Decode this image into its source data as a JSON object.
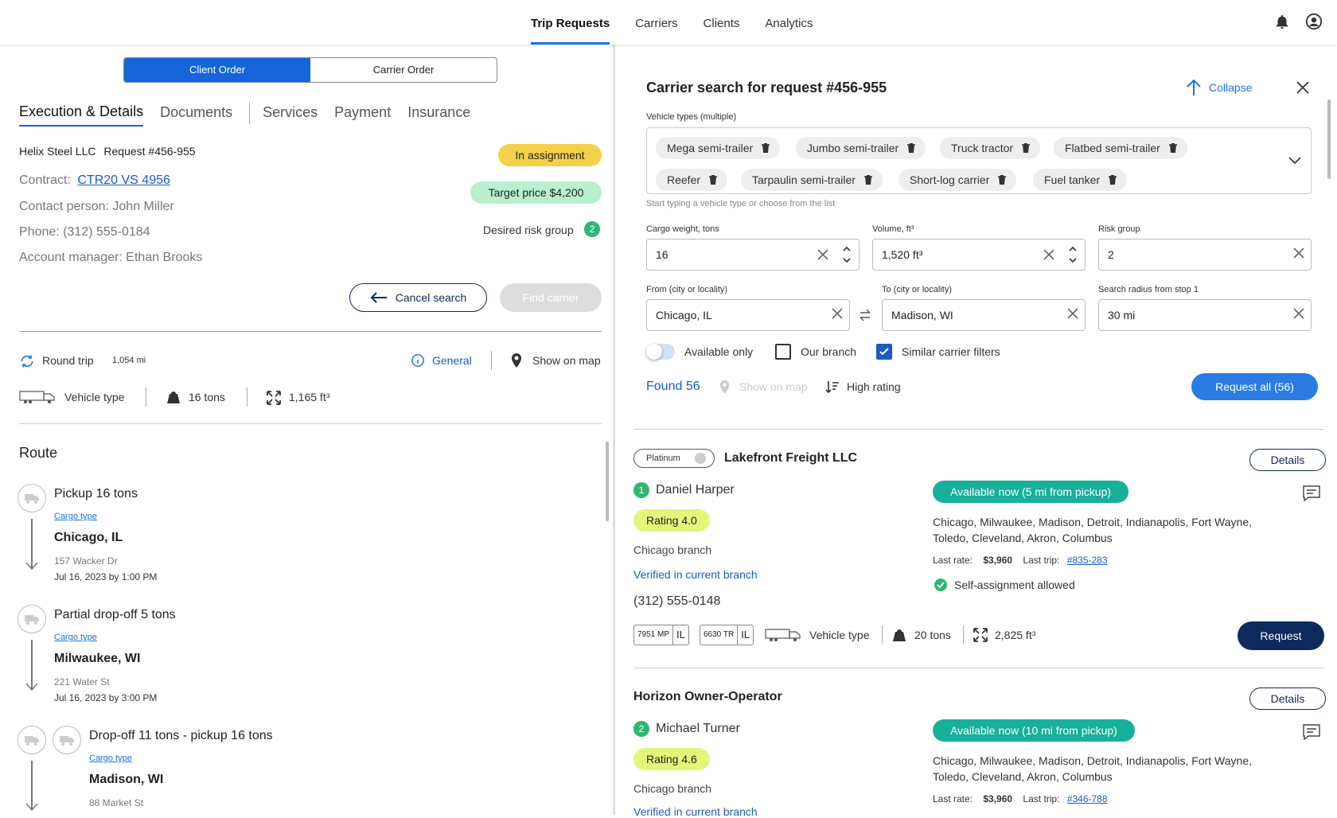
{
  "nav": {
    "items": [
      "Trip Requests",
      "Carriers",
      "Clients",
      "Analytics"
    ]
  },
  "left": {
    "toggle": {
      "client": "Client Order",
      "carrier": "Carrier Order"
    },
    "tabs": [
      "Execution & Details",
      "Documents",
      "Services",
      "Payment",
      "Insurance"
    ],
    "client_name": "Helix Steel LLC",
    "request_label": "Request #456-955",
    "status": "In assignment",
    "contract_label": "Contract:",
    "contract_link": "CTR20 VS 4956",
    "target_price": "Target price $4,200",
    "contact": "Contact person: John Miller",
    "phone": "Phone: (312) 555-0184",
    "desired_risk": "Desired risk group",
    "desired_risk_value": "2",
    "account_manager": "Account manager: Ethan Brooks",
    "cancel": "Cancel search",
    "find": "Find carrier",
    "trip_type": "Round trip",
    "distance": "1,054 mi",
    "general": "General",
    "show_map": "Show on map",
    "vehicle_type": "Vehicle type",
    "tons": "16 tons",
    "volume": "1,165 ft³",
    "route_title": "Route",
    "stops": [
      {
        "title": "Pickup 16 tons",
        "cargo": "Cargo type",
        "city": "Chicago, IL",
        "address": "157 Wacker Dr",
        "time": "Jul 16, 2023 by 1:00 PM"
      },
      {
        "title": "Partial drop-off 5 tons",
        "cargo": "Cargo type",
        "city": "Milwaukee, WI",
        "address": "221 Water St",
        "time": "Jul 16, 2023 by 3:00 PM"
      },
      {
        "title": "Drop-off 11 tons - pickup 16 tons",
        "cargo": "Cargo type",
        "city": "Madison, WI",
        "address": "88 Market St"
      }
    ]
  },
  "right": {
    "title": "Carrier search for request #456-955",
    "collapse": "Collapse",
    "vehicle_types_label": "Vehicle types (multiple)",
    "chips": [
      "Mega semi-trailer",
      "Jumbo semi-trailer",
      "Truck tractor",
      "Flatbed semi-trailer",
      "Reefer",
      "Tarpaulin semi-trailer",
      "Short-log carrier",
      "Fuel tanker"
    ],
    "chip_hint": "Start typing a vehicle type or choose from the list",
    "cargo_weight_label": "Cargo weight, tons",
    "cargo_weight": "16",
    "volume_label": "Volume, ft³",
    "volume": "1,520 ft³",
    "risk_label": "Risk group",
    "risk": "2",
    "from_label": "From (city or locality)",
    "from": "Chicago, IL",
    "to_label": "To (city or locality)",
    "to": "Madison, WI",
    "radius_label": "Search radius from stop 1",
    "radius": "30 mi",
    "available_only": "Available only",
    "our_branch": "Our branch",
    "similar": "Similar carrier filters",
    "found": "Found 56",
    "show_map": "Show on map",
    "sort": "High rating",
    "request_all": "Request all (56)",
    "carriers": [
      {
        "tier": "Platinum",
        "name": "Lakefront Freight LLC",
        "details": "Details",
        "num": "1",
        "driver": "Daniel Harper",
        "available": "Available now (5 mi from pickup)",
        "rating": "Rating 4.0",
        "branch": "Chicago branch",
        "verified": "Verified in current branch",
        "phone": "(312) 555-0148",
        "cities": "Chicago, Milwaukee, Madison, Detroit, Indianapolis, Fort Wayne, Toledo, Cleveland, Akron, Columbus",
        "last_rate_label": "Last rate:",
        "last_rate": "$3,960",
        "last_trip_label": "Last trip:",
        "last_trip": "#835-283",
        "self_assign": "Self-assignment allowed",
        "plate1": "7951 MP",
        "plate1_st": "IL",
        "plate2": "6630 TR",
        "plate2_st": "IL",
        "vehicle_type": "Vehicle type",
        "tons": "20 tons",
        "volume": "2,825 ft³",
        "request": "Request"
      },
      {
        "name": "Horizon Owner-Operator",
        "details": "Details",
        "num": "2",
        "driver": "Michael Turner",
        "available": "Available now (10 mi from pickup)",
        "rating": "Rating 4.6",
        "branch": "Chicago branch",
        "verified": "Verified in current branch",
        "cities": "Chicago, Milwaukee, Madison, Detroit, Indianapolis, Fort Wayne, Toledo, Cleveland, Akron, Columbus",
        "last_rate_label": "Last rate:",
        "last_rate": "$3,960",
        "last_trip_label": "Last trip:",
        "last_trip": "#346-788"
      }
    ]
  },
  "colors": {
    "accent": "#1565d8",
    "navy": "#0d2a5c",
    "available": "#17b09a",
    "rating": "#e5f57a",
    "status": "#f5d04a",
    "target": "#b8f0d0"
  }
}
